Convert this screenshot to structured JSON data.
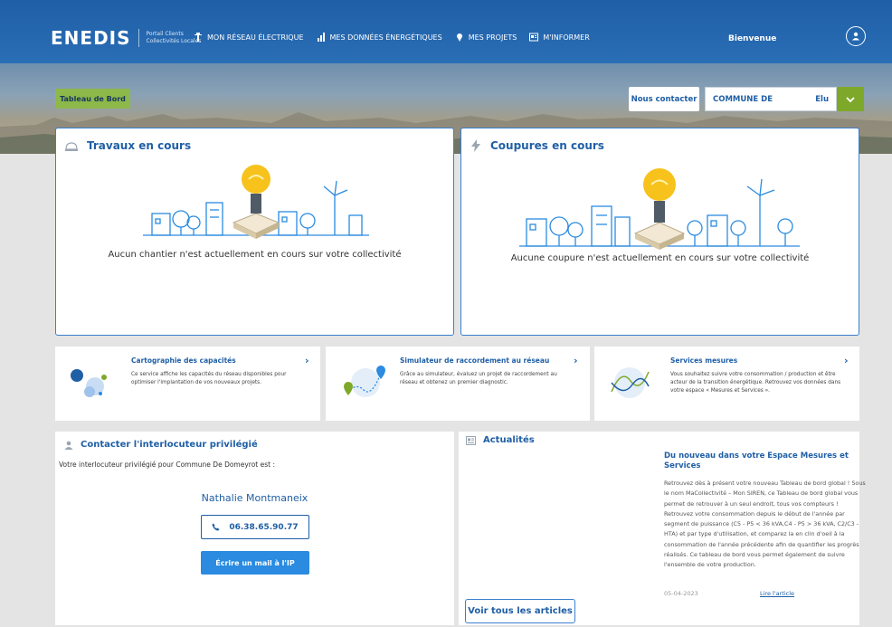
{
  "brand": {
    "logo_text": "ENEDIS",
    "subtitle": "Portail Clients Collectivités Locales",
    "primary_color": "#1f5fa6",
    "accent_green": "#7ea82a"
  },
  "nav": {
    "items": [
      {
        "label": "MON RÉSEAU ÉLECTRIQUE",
        "icon": "power-pole-icon"
      },
      {
        "label": "MES DONNÉES ÉNERGÉTIQUES",
        "icon": "bar-chart-icon"
      },
      {
        "label": "MES PROJETS",
        "icon": "pin-icon"
      },
      {
        "label": "M'INFORMER",
        "icon": "newspaper-icon"
      }
    ],
    "welcome": "Bienvenue"
  },
  "header_actions": {
    "contact": "Nous contacter",
    "commune": "COMMUNE DE",
    "role": "Elu"
  },
  "breadcrumb": {
    "label": "Tableau de Bord"
  },
  "travaux": {
    "title": "Travaux en cours",
    "message": "Aucun chantier n'est actuellement en cours sur votre collectivité"
  },
  "coupures": {
    "title": "Coupures en cours",
    "message": "Aucune coupure n'est actuellement en cours sur votre collectivité"
  },
  "services": [
    {
      "title": "Cartographie des capacités",
      "text": "Ce service affiche les capacités du réseau disponibles pour optimiser l'implantation de vos nouveaux projets."
    },
    {
      "title": "Simulateur de raccordement au réseau",
      "text": "Grâce au simulateur, évaluez un projet de raccordement au réseau et obtenez un premier diagnostic."
    },
    {
      "title": "Services mesures",
      "text": "Vous souhaitez suivre votre consommation / production et être acteur de la transition énergétique. Retrouvez vos données dans votre espace « Mesures et Services »."
    }
  ],
  "interlocuteur": {
    "title": "Contacter l'interlocuteur privilégié",
    "intro": "Votre interlocuteur privilégié pour Commune De Domeyrot est :",
    "name": "Nathalie Montmaneix",
    "phone": "06.38.65.90.77",
    "mail_button": "Écrire un mail à l'IP"
  },
  "actualites": {
    "title": "Actualités",
    "article_title": "Du nouveau dans votre Espace Mesures et Services",
    "article_body": "Retrouvez dès à présent votre nouveau Tableau de bord global ! Sous le nom MaCollectivité – Mon SIREN, ce Tableau de bord global vous permet de retrouver à un seul endroit, tous vos compteurs ! Retrouvez votre consommation depuis le début de l'année par segment de puissance (C5 - P5 < 36 kVA,C4 - P5 > 36 kVA, C2/C3 - HTA) et par type d'utilisation, et comparez la en clin d'oeil à la consommation de l'année précédente afin de quantifier les progrès réalisés. Ce tableau de bord vous permet également de suivre l'ensemble de votre production.",
    "date": "05-04-2023",
    "read_link": "Lire l'article",
    "all_button": "Voir tous les articles"
  }
}
